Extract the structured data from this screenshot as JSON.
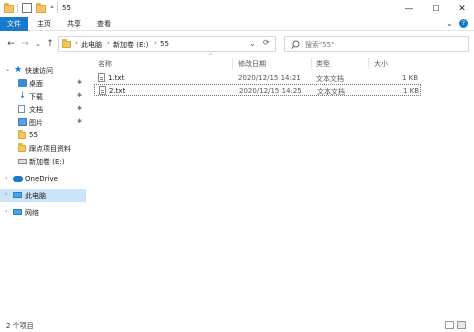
{
  "window": {
    "title": "55",
    "minimize": "—",
    "maximize": "☐",
    "close": "✕"
  },
  "ribbon": {
    "tabs": [
      "文件",
      "主页",
      "共享",
      "查看"
    ],
    "expand": "⌄",
    "help": "?"
  },
  "address": {
    "back": "←",
    "forward": "→",
    "history": "⌄",
    "up": "↑",
    "crumbs": [
      "此电脑",
      "新加卷 (E:)",
      "55"
    ],
    "separator": "›",
    "dropdown": "⌄",
    "refresh": "⟳",
    "search_placeholder": "搜索\"55\""
  },
  "nav": {
    "quick_access": "快速访问",
    "items": [
      {
        "label": "桌面",
        "pinned": true
      },
      {
        "label": "下载",
        "pinned": true
      },
      {
        "label": "文档",
        "pinned": true
      },
      {
        "label": "图片",
        "pinned": true
      },
      {
        "label": "55",
        "pinned": false
      },
      {
        "label": "蹿点项目资料",
        "pinned": false
      },
      {
        "label": "新加卷 (E:)",
        "pinned": false
      }
    ],
    "onedrive": "OneDrive",
    "this_pc": "此电脑",
    "network": "网络",
    "pin_glyph": "✱"
  },
  "columns": {
    "name": "名称",
    "modified": "修改日期",
    "type": "类型",
    "size": "大小",
    "sort_glyph": "^"
  },
  "files": [
    {
      "name": "1.txt",
      "modified": "2020/12/15 14:21",
      "type": "文本文档",
      "size": "1 KB"
    },
    {
      "name": "2.txt",
      "modified": "2020/12/15 14:25",
      "type": "文本文档",
      "size": "1 KB"
    }
  ],
  "status": {
    "count": "2 个项目"
  },
  "colors": {
    "accent": "#1979ca",
    "selection": "#cce4f7",
    "folder": "#f0c75e"
  }
}
